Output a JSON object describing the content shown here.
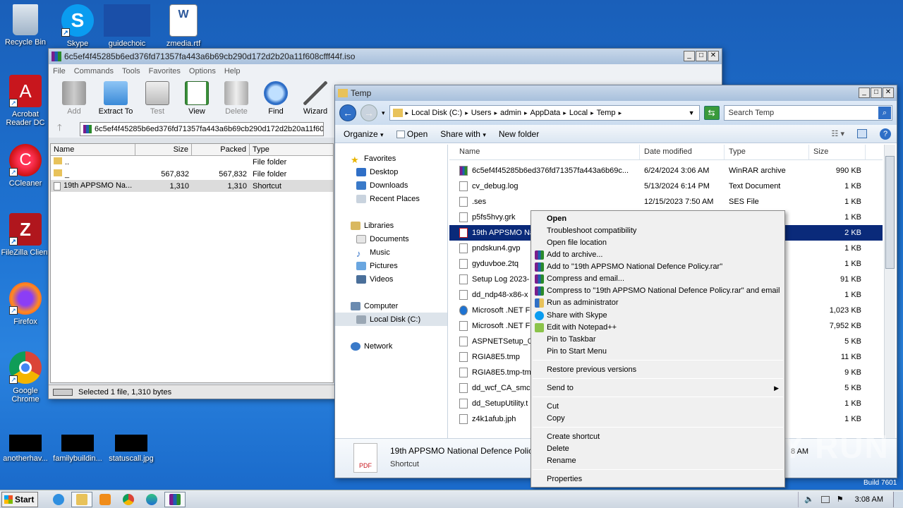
{
  "desktop": {
    "icons": [
      {
        "label": "Recycle Bin"
      },
      {
        "label": "Skype"
      },
      {
        "label": "guidechoic"
      },
      {
        "label": "zmedia.rtf"
      },
      {
        "label": "Acrobat Reader DC"
      },
      {
        "label": "CCleaner"
      },
      {
        "label": "FileZilla Client"
      },
      {
        "label": "Firefox"
      },
      {
        "label": "Google Chrome"
      },
      {
        "label": "anotherhav..."
      },
      {
        "label": "familybuildin..."
      },
      {
        "label": "statuscall.jpg"
      }
    ],
    "watermark": "ANY RUN",
    "build": "Build 7601"
  },
  "winrar": {
    "title": "6c5ef4f45285b6ed376fd71357fa443a6b69cb290d172d2b20a11f608cfff44f.iso",
    "menu": [
      "File",
      "Commands",
      "Tools",
      "Favorites",
      "Options",
      "Help"
    ],
    "toolbar": [
      "Add",
      "Extract To",
      "Test",
      "View",
      "Delete",
      "Find",
      "Wizard"
    ],
    "path": "6c5ef4f45285b6ed376fd71357fa443a6b69cb290d172d2b20a11f608",
    "columns": [
      "Name",
      "Size",
      "Packed",
      "Type"
    ],
    "rows": [
      {
        "name": "..",
        "size": "",
        "packed": "",
        "type": "File folder"
      },
      {
        "name": "_",
        "size": "567,832",
        "packed": "567,832",
        "type": "File folder"
      },
      {
        "name": "19th APPSMO Na...",
        "size": "1,310",
        "packed": "1,310",
        "type": "Shortcut"
      }
    ],
    "status": "Selected 1 file, 1,310 bytes"
  },
  "explorer": {
    "title": "Temp",
    "breadcrumb": [
      "Local Disk (C:)",
      "Users",
      "admin",
      "AppData",
      "Local",
      "Temp"
    ],
    "search_placeholder": "Search Temp",
    "commands": [
      "Organize",
      "Open",
      "Share with",
      "New folder"
    ],
    "nav": {
      "favorites": "Favorites",
      "desktop": "Desktop",
      "downloads": "Downloads",
      "recent": "Recent Places",
      "libraries": "Libraries",
      "documents": "Documents",
      "music": "Music",
      "pictures": "Pictures",
      "videos": "Videos",
      "computer": "Computer",
      "localdisk": "Local Disk (C:)",
      "network": "Network"
    },
    "columns": [
      "Name",
      "Date modified",
      "Type",
      "Size"
    ],
    "rows": [
      {
        "name": "6c5ef4f45285b6ed376fd71357fa443a6b69c...",
        "date": "6/24/2024 3:06 AM",
        "type": "WinRAR archive",
        "size": "990 KB"
      },
      {
        "name": "cv_debug.log",
        "date": "5/13/2024 6:14 PM",
        "type": "Text Document",
        "size": "1 KB"
      },
      {
        "name": ".ses",
        "date": "12/15/2023 7:50 AM",
        "type": "SES File",
        "size": "1 KB"
      },
      {
        "name": "p5fs5hvy.grk",
        "date": "",
        "type": "",
        "size": "1 KB"
      },
      {
        "name": "19th APPSMO Na",
        "date": "",
        "type": "",
        "size": "2 KB"
      },
      {
        "name": "pndskun4.gvp",
        "date": "",
        "type": "",
        "size": "1 KB"
      },
      {
        "name": "gyduvboe.2tq",
        "date": "",
        "type": "",
        "size": "1 KB"
      },
      {
        "name": "Setup Log 2023-",
        "date": "",
        "type": "",
        "size": "91 KB"
      },
      {
        "name": "dd_ndp48-x86-x",
        "date": "",
        "type": "",
        "size": "1 KB"
      },
      {
        "name": "Microsoft .NET F",
        "date": "",
        "type": "TM...",
        "size": "1,023 KB"
      },
      {
        "name": "Microsoft .NET F",
        "date": "",
        "type": "",
        "size": "7,952 KB"
      },
      {
        "name": "ASPNETSetup_0",
        "date": "",
        "type": "",
        "size": "5 KB"
      },
      {
        "name": "RGIA8E5.tmp",
        "date": "",
        "type": "",
        "size": "11 KB"
      },
      {
        "name": "RGIA8E5.tmp-tm",
        "date": "",
        "type": "",
        "size": "9 KB"
      },
      {
        "name": "dd_wcf_CA_smc",
        "date": "",
        "type": "",
        "size": "5 KB"
      },
      {
        "name": "dd_SetupUtility.t",
        "date": "",
        "type": "",
        "size": "1 KB"
      },
      {
        "name": "z4k1afub.jph",
        "date": "",
        "type": "",
        "size": "1 KB"
      }
    ],
    "details": {
      "name": "19th APPSMO National Defence Polic",
      "type": "Shortcut",
      "time_partial": "8 AM"
    }
  },
  "context_menu": {
    "items": [
      "Open",
      "Troubleshoot compatibility",
      "Open file location",
      "Add to archive...",
      "Add to \"19th APPSMO National Defence Policy.rar\"",
      "Compress and email...",
      "Compress to \"19th APPSMO National Defence Policy.rar\" and email",
      "Run as administrator",
      "Share with Skype",
      "Edit with Notepad++",
      "Pin to Taskbar",
      "Pin to Start Menu",
      "Restore previous versions",
      "Send to",
      "Cut",
      "Copy",
      "Create shortcut",
      "Delete",
      "Rename",
      "Properties"
    ]
  },
  "taskbar": {
    "start": "Start",
    "clock": "3:08 AM"
  }
}
